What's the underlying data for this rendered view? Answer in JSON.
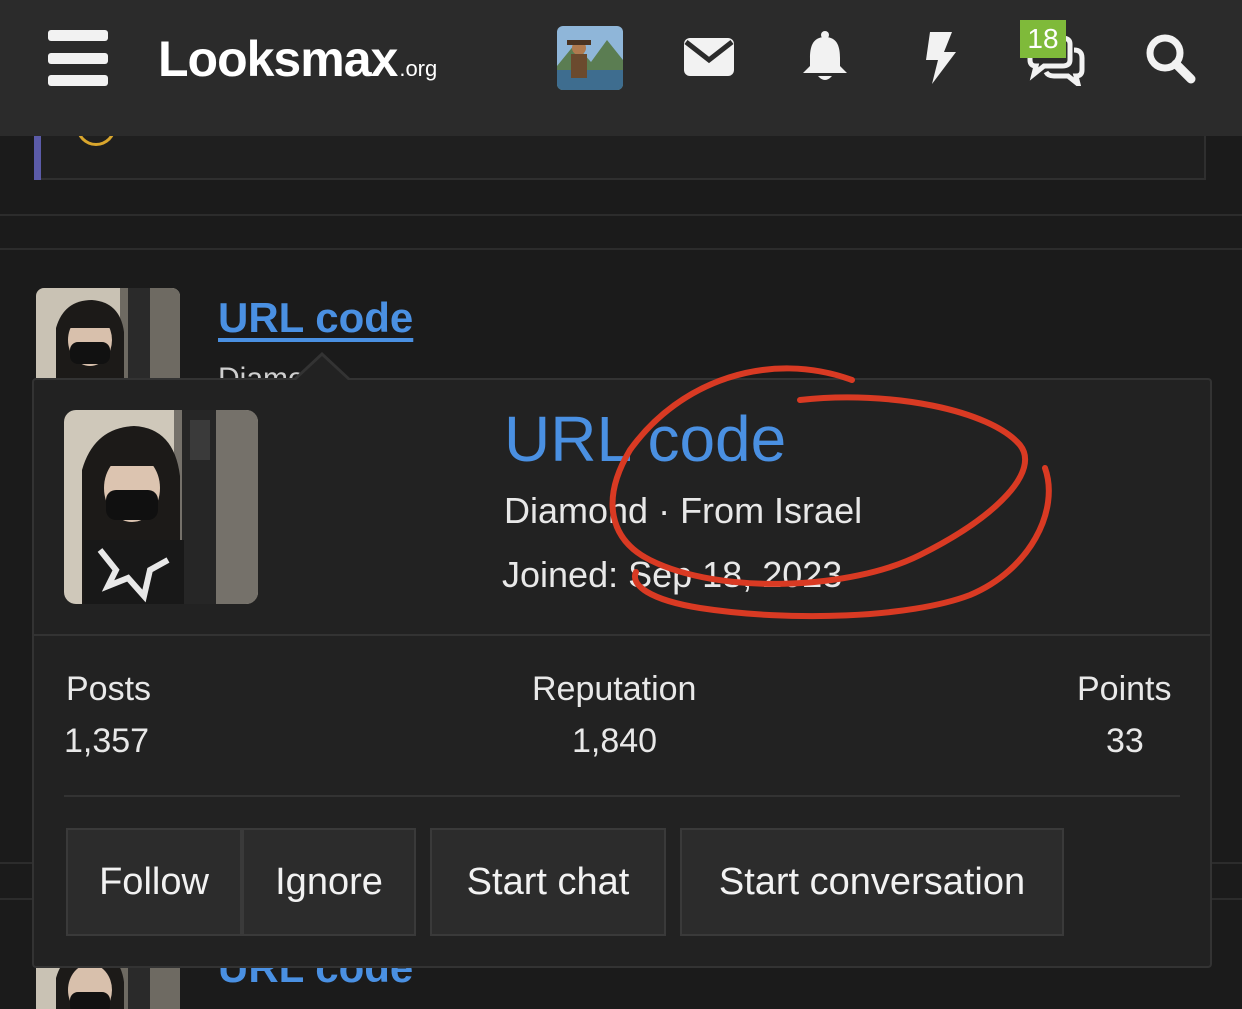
{
  "header": {
    "logo_main": "Looksmax",
    "logo_suffix": ".org",
    "notification_badge": "18",
    "icons": [
      "menu-icon",
      "avatar",
      "mail-icon",
      "bell-icon",
      "bolt-icon",
      "chat-icon",
      "search-icon"
    ]
  },
  "list": {
    "name": "URL code",
    "subtitle": "Diamond",
    "name_second": "URL code"
  },
  "card": {
    "username": "URL code",
    "meta_line": "Diamond · From Israel",
    "joined": "Joined: Sep 18, 2023",
    "stats": [
      {
        "label": "Posts",
        "value": "1,357"
      },
      {
        "label": "Reputation",
        "value": "1,840"
      },
      {
        "label": "Points",
        "value": "33"
      }
    ],
    "buttons": [
      "Follow",
      "Ignore",
      "Start chat",
      "Start conversation"
    ]
  },
  "colors": {
    "accent_link": "#4a90e2",
    "badge": "#7fba3a",
    "annotation": "#d93a23"
  }
}
